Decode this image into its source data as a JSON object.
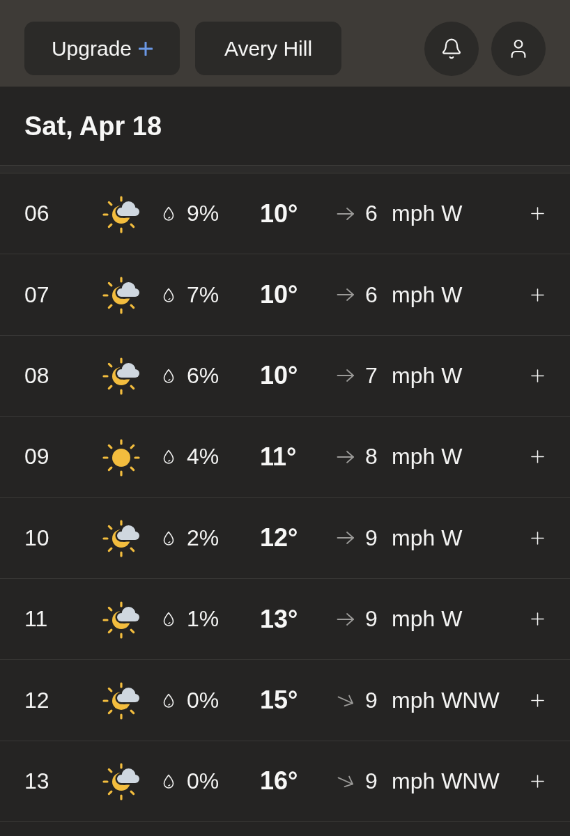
{
  "header": {
    "upgrade_button": {
      "label": "Upgrade"
    },
    "location_button": {
      "label": "Avery Hill"
    }
  },
  "date": "Sat, Apr 18",
  "hours": [
    {
      "hour": "06",
      "kind": "partly_cloudy",
      "precip": "9%",
      "temp": "10°",
      "wind": {
        "kind": "e",
        "speed": "6",
        "label": "mph W"
      }
    },
    {
      "hour": "07",
      "kind": "partly_cloudy",
      "precip": "7%",
      "temp": "10°",
      "wind": {
        "kind": "e",
        "speed": "6",
        "label": "mph W"
      }
    },
    {
      "hour": "08",
      "kind": "partly_cloudy",
      "precip": "6%",
      "temp": "10°",
      "wind": {
        "kind": "e",
        "speed": "7",
        "label": "mph W"
      }
    },
    {
      "hour": "09",
      "kind": "sunny",
      "precip": "4%",
      "temp": "11°",
      "wind": {
        "kind": "e",
        "speed": "8",
        "label": "mph W"
      }
    },
    {
      "hour": "10",
      "kind": "partly_cloudy",
      "precip": "2%",
      "temp": "12°",
      "wind": {
        "kind": "e",
        "speed": "9",
        "label": "mph W"
      }
    },
    {
      "hour": "11",
      "kind": "partly_cloudy",
      "precip": "1%",
      "temp": "13°",
      "wind": {
        "kind": "e",
        "speed": "9",
        "label": "mph W"
      }
    },
    {
      "hour": "12",
      "kind": "partly_cloudy",
      "precip": "0%",
      "temp": "15°",
      "wind": {
        "kind": "ese",
        "speed": "9",
        "label": "mph WNW"
      }
    },
    {
      "hour": "13",
      "kind": "partly_cloudy",
      "precip": "0%",
      "temp": "16°",
      "wind": {
        "kind": "ese",
        "speed": "9",
        "label": "mph WNW"
      }
    }
  ]
}
